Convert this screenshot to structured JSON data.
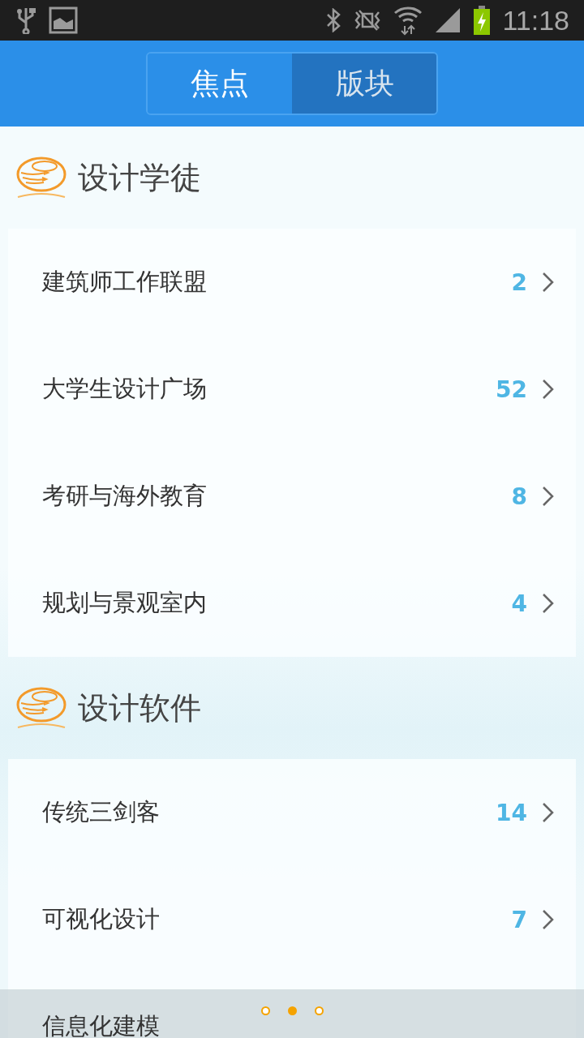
{
  "status_bar": {
    "time": "11:18"
  },
  "tabs": [
    {
      "label": "焦点",
      "selected": false
    },
    {
      "label": "版块",
      "selected": true
    }
  ],
  "sections": [
    {
      "title": "设计学徒",
      "items": [
        {
          "label": "建筑师工作联盟",
          "count": "2"
        },
        {
          "label": "大学生设计广场",
          "count": "52"
        },
        {
          "label": "考研与海外教育",
          "count": "8"
        },
        {
          "label": "规划与景观室内",
          "count": "4"
        }
      ]
    },
    {
      "title": "设计软件",
      "items": [
        {
          "label": "传统三剑客",
          "count": "14"
        },
        {
          "label": "可视化设计",
          "count": "7"
        },
        {
          "label": "信息化建模"
        }
      ]
    }
  ],
  "pager": [
    {
      "selected": false
    },
    {
      "selected": true
    },
    {
      "selected": false
    }
  ]
}
